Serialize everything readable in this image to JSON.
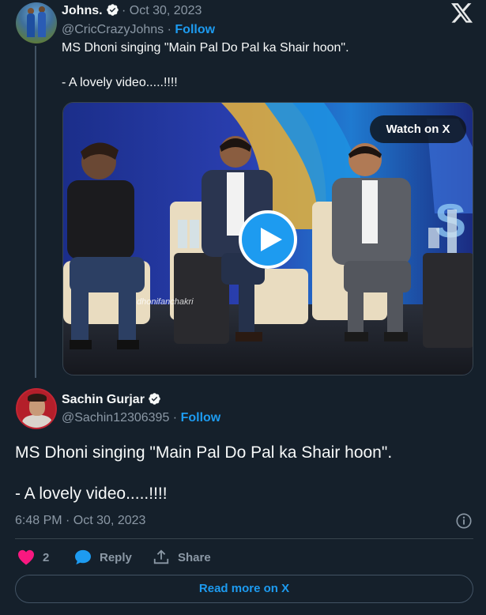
{
  "quoted_tweet": {
    "author_name": "Johns.",
    "date": "· Oct 30, 2023",
    "handle": "@CricCrazyJohns ·",
    "follow_label": "Follow",
    "text_line1": "MS Dhoni singing \"Main Pal Do Pal ka Shair hoon\".",
    "text_line2": "- A lovely video.....!!!!",
    "video": {
      "watch_label": "Watch on X",
      "watermark": "dhonifanchakri"
    }
  },
  "main_tweet": {
    "author_name": "Sachin Gurjar",
    "handle": "@Sachin12306395 ·",
    "follow_label": "Follow",
    "text_line1": "MS Dhoni singing \"Main Pal Do Pal ka Shair hoon\".",
    "text_line2": "- A lovely video.....!!!!",
    "timestamp": "6:48 PM · Oct 30, 2023"
  },
  "actions": {
    "like_count": "2",
    "reply_label": "Reply",
    "share_label": "Share"
  },
  "read_more_label": "Read more on X",
  "icons": {
    "brand": "x-logo-icon",
    "verified": "verified-badge-icon",
    "play": "play-icon",
    "info": "info-icon",
    "like": "heart-icon",
    "reply": "reply-bubble-icon",
    "share": "share-upload-icon"
  },
  "colors": {
    "background": "#15202b",
    "accent": "#1d9bf0",
    "text": "#f7f9f9",
    "muted": "#8b98a5",
    "like": "#f91880"
  }
}
